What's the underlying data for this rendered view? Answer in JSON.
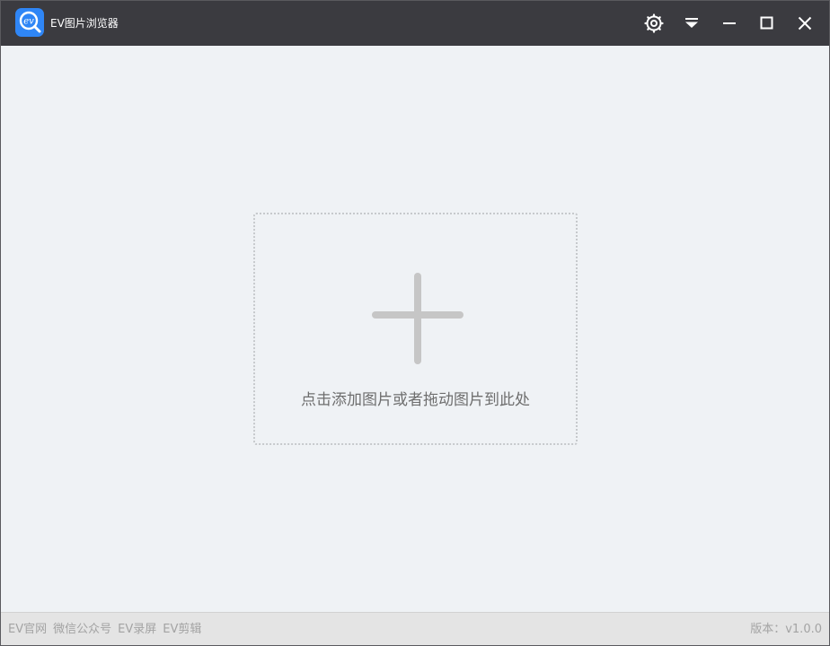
{
  "app": {
    "title": "EV图片浏览器",
    "logo_text": "ev",
    "logo_icon": "ev-logo-icon"
  },
  "title_controls": [
    {
      "name": "settings-button",
      "icon": "gear-icon"
    },
    {
      "name": "menu-button",
      "icon": "dropdown-menu-icon"
    },
    {
      "name": "minimize-button",
      "icon": "minimize-icon"
    },
    {
      "name": "maximize-button",
      "icon": "maximize-icon"
    },
    {
      "name": "close-button",
      "icon": "close-icon"
    }
  ],
  "dropzone": {
    "icon": "plus-icon",
    "label": "点击添加图片或者拖动图片到此处"
  },
  "footer": {
    "links": [
      "EV官网",
      "微信公众号",
      "EV录屏",
      "EV剪辑"
    ],
    "version": "版本：v1.0.0"
  },
  "colors": {
    "titlebar": "#3b3b40",
    "background": "#eff2f5",
    "accent": "#2f86f6",
    "footer": "#e4e4e4"
  }
}
